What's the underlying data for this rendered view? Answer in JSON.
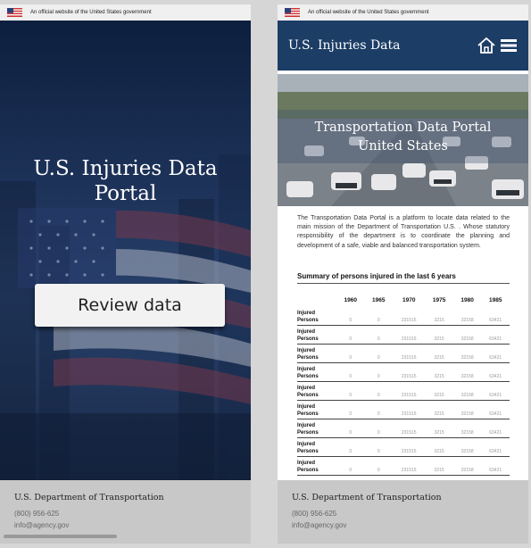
{
  "gov_banner": {
    "text": "An official website of the United States government"
  },
  "left_screen": {
    "hero_title": "U.S. Injuries Data Portal",
    "review_button": "Review data"
  },
  "right_screen": {
    "brand": "U.S. Injuries Data",
    "hero_title_line1": "Transportation Data Portal",
    "hero_title_line2": "United States",
    "intro": "The Transportation Data Portal is a platform to locate data related to the main mission of the Department of Transportation U.S. . Whose statutory responsibility of the department is to coordinate the planning and development of a safe, viable and balanced transportation system.",
    "table_title": "Summary of  persons injured in the last  6 years",
    "columns": [
      "1960",
      "1965",
      "1970",
      "1975",
      "1980",
      "1985"
    ],
    "row_label": "Injured Persons",
    "rows": [
      [
        "0",
        "0",
        "231515",
        "3215",
        "32158",
        "63421"
      ],
      [
        "0",
        "0",
        "231515",
        "3215",
        "32158",
        "63421"
      ],
      [
        "0",
        "0",
        "231515",
        "3215",
        "32158",
        "63421"
      ],
      [
        "0",
        "0",
        "231515",
        "3215",
        "32158",
        "63421"
      ],
      [
        "0",
        "0",
        "231515",
        "3215",
        "32158",
        "63421"
      ],
      [
        "0",
        "0",
        "231515",
        "3215",
        "32158",
        "63421"
      ],
      [
        "0",
        "0",
        "231515",
        "3215",
        "32158",
        "63421"
      ],
      [
        "0",
        "0",
        "231515",
        "3215",
        "32158",
        "63421"
      ],
      [
        "0",
        "0",
        "231515",
        "3215",
        "32158",
        "63421"
      ]
    ]
  },
  "footer": {
    "dept": "U.S. Department of Transportation",
    "phone": "(800) 956-625",
    "email": "info@agency.gov"
  },
  "colors": {
    "header": "#1c3d66",
    "footer": "#c8c8c8",
    "hero_left": "#1d3258"
  },
  "icons": {
    "home": "home-icon",
    "menu": "hamburger-menu-icon",
    "flag": "us-flag-icon"
  }
}
